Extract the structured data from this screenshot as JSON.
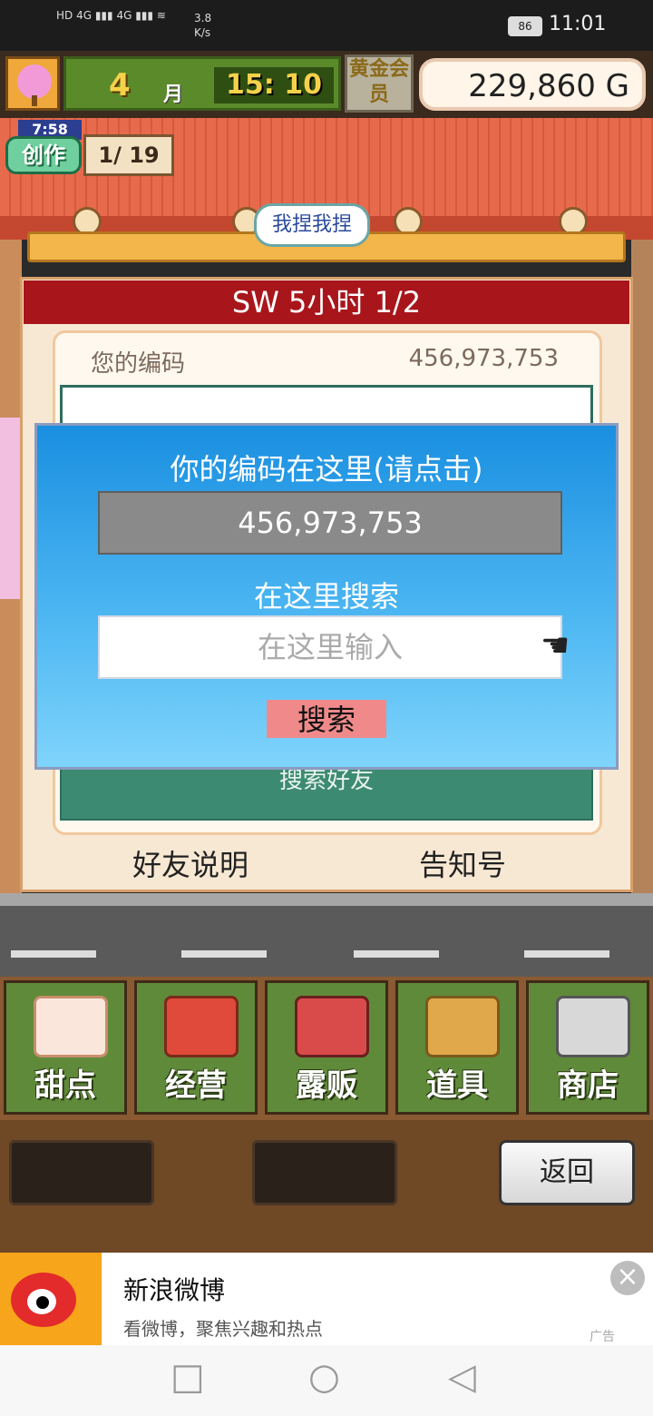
{
  "status_bar": {
    "network_speed": "3.8\nK/s",
    "battery": "86",
    "time": "11:01"
  },
  "top": {
    "month": "4",
    "month_label": "月",
    "time": "15: 10",
    "gold_badge": "黄金会员",
    "money": "229,860 G"
  },
  "create": {
    "timer": "7:58",
    "label": "创作",
    "count": "1/ 19"
  },
  "bubble": "我捏我捏",
  "panel": {
    "title": "SW  5小时 1/2",
    "code_label": "您的编码",
    "code_value": "456,973,753",
    "search_friends": "搜索好友",
    "friend_help": "好友说明",
    "notice_num": "告知号"
  },
  "dialog": {
    "title": "你的编码在这里(请点击)",
    "code": "456,973,753",
    "search_label": "在这里搜索",
    "input_placeholder": "在这里输入",
    "search_button": "搜索"
  },
  "menu": [
    {
      "label": "甜点",
      "icon": "cake-icon"
    },
    {
      "label": "经营",
      "icon": "shop-icon"
    },
    {
      "label": "露贩",
      "icon": "food-truck-icon"
    },
    {
      "label": "道具",
      "icon": "item-bag-icon"
    },
    {
      "label": "商店",
      "icon": "cart-icon"
    }
  ],
  "back_button": "返回",
  "ad": {
    "title": "新浪微博",
    "subtitle": "看微博，聚焦兴趣和热点",
    "tag": "广告"
  },
  "colors": {
    "panel_title": "#a8161b",
    "dialog_top": "#1a8fe0",
    "search_button": "#f08a8a"
  }
}
